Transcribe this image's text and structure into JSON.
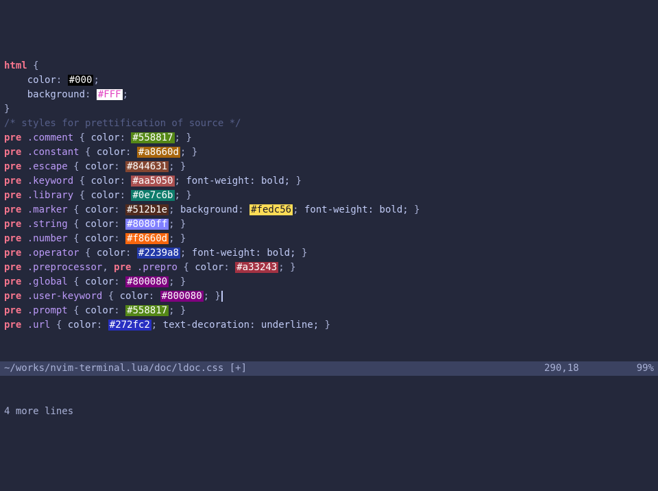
{
  "lines": [
    {
      "type": "sel-open",
      "selector": "html",
      "suffix": " {"
    },
    {
      "type": "decl-hex",
      "indent": "    ",
      "prop": "color",
      "hex": "#000",
      "bg": "#000000",
      "fg": "#ffffff"
    },
    {
      "type": "decl-hex",
      "indent": "    ",
      "prop": "background",
      "hex": "#FFF",
      "bg": "#ffffff",
      "fg": "#e042c0"
    },
    {
      "type": "raw",
      "text": "}"
    },
    {
      "type": "comment",
      "text": "/* styles for prettification of source */"
    },
    {
      "type": "rule-hex",
      "kw": "pre",
      "cls": ".comment",
      "prop": "color",
      "hex": "#558817",
      "bg": "#558817",
      "fg": "#ffffff"
    },
    {
      "type": "rule-hex",
      "kw": "pre",
      "cls": ".constant",
      "prop": "color",
      "hex": "#a8660d",
      "bg": "#a8660d",
      "fg": "#ffffff"
    },
    {
      "type": "rule-hex",
      "kw": "pre",
      "cls": ".escape",
      "prop": "color",
      "hex": "#844631",
      "bg": "#844631",
      "fg": "#ffffff"
    },
    {
      "type": "rule-hex-extra",
      "kw": "pre",
      "cls": ".keyword",
      "prop": "color",
      "hex": "#aa5050",
      "bg": "#aa5050",
      "fg": "#ffffff",
      "extra": " font-weight: bold;"
    },
    {
      "type": "rule-hex",
      "kw": "pre",
      "cls": ".library",
      "prop": "color",
      "hex": "#0e7c6b",
      "bg": "#0e7c6b",
      "fg": "#ffffff"
    },
    {
      "type": "rule-marker",
      "kw": "pre",
      "cls": ".marker",
      "prop1": "color",
      "hex1": "#512b1e",
      "bg1": "#512b1e",
      "fg1": "#ffffff",
      "prop2": "background",
      "hex2": "#fedc56",
      "bg2": "#fedc56",
      "fg2": "#1a1b26",
      "extra": " font-weight: bold;"
    },
    {
      "type": "rule-hex",
      "kw": "pre",
      "cls": ".string",
      "prop": "color",
      "hex": "#8080ff",
      "bg": "#8080ff",
      "fg": "#ffffff"
    },
    {
      "type": "rule-hex",
      "kw": "pre",
      "cls": ".number",
      "prop": "color",
      "hex": "#f8660d",
      "bg": "#f8660d",
      "fg": "#ffffff"
    },
    {
      "type": "rule-hex-extra",
      "kw": "pre",
      "cls": ".operator",
      "prop": "color",
      "hex": "#2239a8",
      "bg": "#2239a8",
      "fg": "#ffffff",
      "extra": " font-weight: bold;"
    },
    {
      "type": "rule-prepro",
      "kw1": "pre",
      "cls1": ".preprocessor",
      "kw2": "pre",
      "cls2": ".prepro",
      "prop": "color",
      "hex": "#a33243",
      "bg": "#a33243",
      "fg": "#ffffff"
    },
    {
      "type": "rule-hex",
      "kw": "pre",
      "cls": ".global",
      "prop": "color",
      "hex": "#800080",
      "bg": "#800080",
      "fg": "#ffffff"
    },
    {
      "type": "rule-hex",
      "kw": "pre",
      "cls": ".user-keyword",
      "prop": "color",
      "hex": "#800080",
      "bg": "#800080",
      "fg": "#ffffff"
    },
    {
      "type": "rule-hex",
      "kw": "pre",
      "cls": ".prompt",
      "prop": "color",
      "hex": "#558817",
      "bg": "#558817",
      "fg": "#ffffff"
    },
    {
      "type": "rule-hex-extra",
      "kw": "pre",
      "cls": ".url",
      "prop": "color",
      "hex": "#272fc2",
      "bg": "#272fc2",
      "fg": "#ffffff",
      "extra": " text-decoration: underline;"
    }
  ],
  "status": {
    "path": "~/works/nvim-terminal.lua/doc/ldoc.css",
    "modified": "[+]",
    "pos": "290,18",
    "pct": "99%"
  },
  "cmdline": "4 more lines",
  "cursor_line_index": 16
}
